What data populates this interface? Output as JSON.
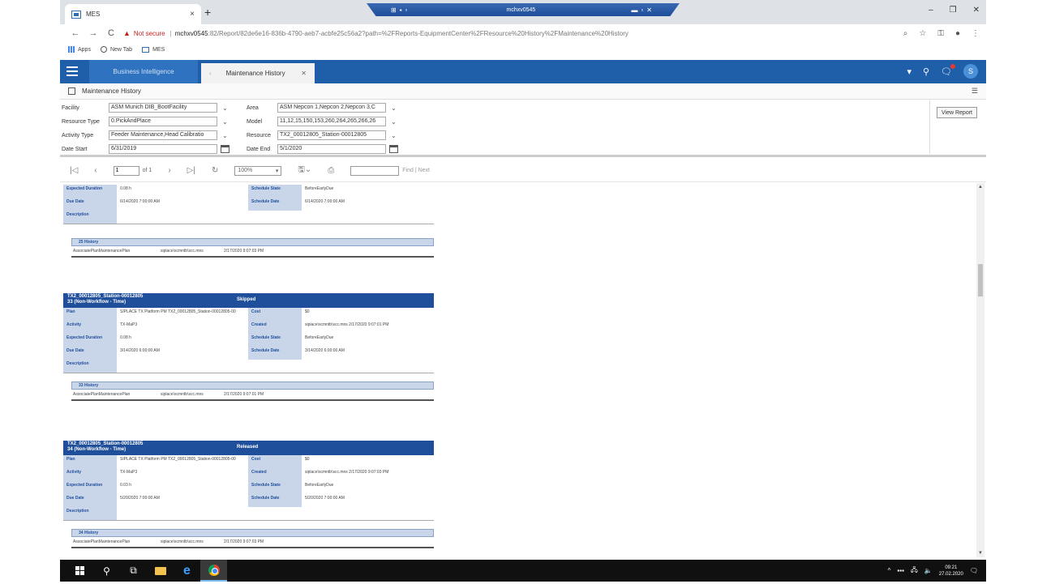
{
  "browser": {
    "tab_title": "MES",
    "tab_close": "×",
    "new_tab": "+",
    "remote_title": "mchxv0545",
    "not_secure": "Not secure",
    "url_host": "mchxv0545",
    "url_path": ":82/Report/82de6e16-836b-4790-aeb7-acbfe25c56a2?path=%2FReports-EquipmentCenter%2FResource%20History%2FMaintenance%20History",
    "bookmarks": [
      {
        "label": "Apps"
      },
      {
        "label": "New Tab"
      },
      {
        "label": "MES"
      }
    ]
  },
  "app": {
    "tabs": [
      {
        "label": "Business Intelligence"
      },
      {
        "label": "Maintenance History"
      }
    ],
    "avatar_initial": "S",
    "subheader_title": "Maintenance History"
  },
  "params": {
    "facility": {
      "label": "Facility",
      "value": "ASM Munich DIB_BootFacility"
    },
    "resource_type": {
      "label": "Resource Type",
      "value": "0.PickAndPlace"
    },
    "activity_type": {
      "label": "Activity Type",
      "value": "Feeder Maintenance,Head Calibratio"
    },
    "date_start": {
      "label": "Date Start",
      "value": "6/31/2019"
    },
    "area": {
      "label": "Area",
      "value": "ASM Nepcon 1,Nepcon 2,Nepcon 3,C"
    },
    "model": {
      "label": "Model",
      "value": "11,12,15,150,153,260,264,265,266,26"
    },
    "resource": {
      "label": "Resource",
      "value": "TX2_00012805_Station-00012805"
    },
    "date_end": {
      "label": "Date End",
      "value": "5/1/2020"
    },
    "view_report": "View Report"
  },
  "toolbar": {
    "page_value": "1",
    "page_of": "of 1",
    "zoom": "100%",
    "find_next": "Find | Next"
  },
  "report": {
    "top_partial": {
      "left": [
        {
          "label": "Expected Duration",
          "value": "0.08 h"
        },
        {
          "label": "Due Date",
          "value": "6/14/2020 7:00:00 AM"
        },
        {
          "label": "Description",
          "value": ""
        }
      ],
      "right": [
        {
          "label": "Schedule State",
          "value": "BeforeEarlyDue"
        },
        {
          "label": "Schedule Date",
          "value": "6/14/2020 7:00:00 AM"
        }
      ],
      "history_header": "25 History",
      "history": {
        "type": "AssociatePlanMaintenancePlan",
        "user": "siplace\\scmntb\\scc.mns",
        "date": "2/17/2020 9:07:03 PM"
      }
    },
    "blocks": [
      {
        "resource": "TX2_00012805_Station-00012805",
        "id": "33 (Non-Workflow - Time)",
        "state": "Skipped",
        "left": [
          {
            "label": "Plan",
            "value": "SIPLACE TX Platform PM TX2_00012805_Station-00012805-00"
          },
          {
            "label": "Activity",
            "value": "TX-MaP3"
          },
          {
            "label": "Expected Duration",
            "value": "0.08 h"
          },
          {
            "label": "Due Date",
            "value": "3/14/2020 6:00:00 AM"
          },
          {
            "label": "Description",
            "value": ""
          }
        ],
        "right": [
          {
            "label": "Cost",
            "value": "$0"
          },
          {
            "label": "Created",
            "value": "siplace\\scmntb\\scc.mns 2/17/2020 9:07:01 PM"
          },
          {
            "label": "Schedule State",
            "value": "BeforeEarlyDue"
          },
          {
            "label": "Schedule Date",
            "value": "3/14/2020 6:00:00 AM"
          }
        ],
        "history_header": "33 History",
        "history": {
          "type": "AssociatePlanMaintenancePlan",
          "user": "siplace\\scmntb\\scc.mns",
          "date": "2/17/2020 9:07:01 PM"
        }
      },
      {
        "resource": "TX2_00012805_Station-00012805",
        "id": "34 (Non-Workflow - Time)",
        "state": "Released",
        "left": [
          {
            "label": "Plan",
            "value": "SIPLACE TX Platform PM TX2_00012805_Station-00012805-00"
          },
          {
            "label": "Activity",
            "value": "TX-MaP3"
          },
          {
            "label": "Expected Duration",
            "value": "0.03 h"
          },
          {
            "label": "Due Date",
            "value": "5/20/2020 7:00:00 AM"
          },
          {
            "label": "Description",
            "value": ""
          }
        ],
        "right": [
          {
            "label": "Cost",
            "value": "$0"
          },
          {
            "label": "Created",
            "value": "siplace\\scmntb\\scc.mns 2/17/2020 9:07:03 PM"
          },
          {
            "label": "Schedule State",
            "value": "BeforeEarlyDue"
          },
          {
            "label": "Schedule Date",
            "value": "5/20/2020 7:00:00 AM"
          }
        ],
        "history_header": "34 History",
        "history": {
          "type": "AssociatePlanMaintenancePlan",
          "user": "siplace\\scmntb\\scc.mns",
          "date": "2/17/2020 9:07:03 PM"
        }
      }
    ]
  },
  "taskbar": {
    "time": "09:21",
    "date": "27.02.2020"
  },
  "colors": {
    "app_header": "#1f5ea8",
    "report_header": "#1f4e9a",
    "label_bg": "#c9d6ea"
  }
}
